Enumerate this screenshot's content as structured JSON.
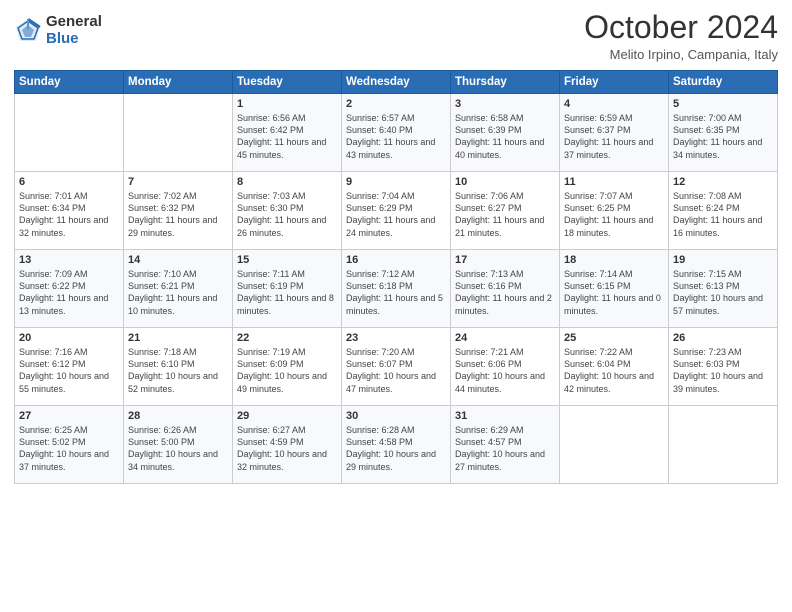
{
  "header": {
    "logo_general": "General",
    "logo_blue": "Blue",
    "month_title": "October 2024",
    "location": "Melito Irpino, Campania, Italy"
  },
  "days_of_week": [
    "Sunday",
    "Monday",
    "Tuesday",
    "Wednesday",
    "Thursday",
    "Friday",
    "Saturday"
  ],
  "weeks": [
    [
      {
        "day": "",
        "content": ""
      },
      {
        "day": "",
        "content": ""
      },
      {
        "day": "1",
        "content": "Sunrise: 6:56 AM\nSunset: 6:42 PM\nDaylight: 11 hours and 45 minutes."
      },
      {
        "day": "2",
        "content": "Sunrise: 6:57 AM\nSunset: 6:40 PM\nDaylight: 11 hours and 43 minutes."
      },
      {
        "day": "3",
        "content": "Sunrise: 6:58 AM\nSunset: 6:39 PM\nDaylight: 11 hours and 40 minutes."
      },
      {
        "day": "4",
        "content": "Sunrise: 6:59 AM\nSunset: 6:37 PM\nDaylight: 11 hours and 37 minutes."
      },
      {
        "day": "5",
        "content": "Sunrise: 7:00 AM\nSunset: 6:35 PM\nDaylight: 11 hours and 34 minutes."
      }
    ],
    [
      {
        "day": "6",
        "content": "Sunrise: 7:01 AM\nSunset: 6:34 PM\nDaylight: 11 hours and 32 minutes."
      },
      {
        "day": "7",
        "content": "Sunrise: 7:02 AM\nSunset: 6:32 PM\nDaylight: 11 hours and 29 minutes."
      },
      {
        "day": "8",
        "content": "Sunrise: 7:03 AM\nSunset: 6:30 PM\nDaylight: 11 hours and 26 minutes."
      },
      {
        "day": "9",
        "content": "Sunrise: 7:04 AM\nSunset: 6:29 PM\nDaylight: 11 hours and 24 minutes."
      },
      {
        "day": "10",
        "content": "Sunrise: 7:06 AM\nSunset: 6:27 PM\nDaylight: 11 hours and 21 minutes."
      },
      {
        "day": "11",
        "content": "Sunrise: 7:07 AM\nSunset: 6:25 PM\nDaylight: 11 hours and 18 minutes."
      },
      {
        "day": "12",
        "content": "Sunrise: 7:08 AM\nSunset: 6:24 PM\nDaylight: 11 hours and 16 minutes."
      }
    ],
    [
      {
        "day": "13",
        "content": "Sunrise: 7:09 AM\nSunset: 6:22 PM\nDaylight: 11 hours and 13 minutes."
      },
      {
        "day": "14",
        "content": "Sunrise: 7:10 AM\nSunset: 6:21 PM\nDaylight: 11 hours and 10 minutes."
      },
      {
        "day": "15",
        "content": "Sunrise: 7:11 AM\nSunset: 6:19 PM\nDaylight: 11 hours and 8 minutes."
      },
      {
        "day": "16",
        "content": "Sunrise: 7:12 AM\nSunset: 6:18 PM\nDaylight: 11 hours and 5 minutes."
      },
      {
        "day": "17",
        "content": "Sunrise: 7:13 AM\nSunset: 6:16 PM\nDaylight: 11 hours and 2 minutes."
      },
      {
        "day": "18",
        "content": "Sunrise: 7:14 AM\nSunset: 6:15 PM\nDaylight: 11 hours and 0 minutes."
      },
      {
        "day": "19",
        "content": "Sunrise: 7:15 AM\nSunset: 6:13 PM\nDaylight: 10 hours and 57 minutes."
      }
    ],
    [
      {
        "day": "20",
        "content": "Sunrise: 7:16 AM\nSunset: 6:12 PM\nDaylight: 10 hours and 55 minutes."
      },
      {
        "day": "21",
        "content": "Sunrise: 7:18 AM\nSunset: 6:10 PM\nDaylight: 10 hours and 52 minutes."
      },
      {
        "day": "22",
        "content": "Sunrise: 7:19 AM\nSunset: 6:09 PM\nDaylight: 10 hours and 49 minutes."
      },
      {
        "day": "23",
        "content": "Sunrise: 7:20 AM\nSunset: 6:07 PM\nDaylight: 10 hours and 47 minutes."
      },
      {
        "day": "24",
        "content": "Sunrise: 7:21 AM\nSunset: 6:06 PM\nDaylight: 10 hours and 44 minutes."
      },
      {
        "day": "25",
        "content": "Sunrise: 7:22 AM\nSunset: 6:04 PM\nDaylight: 10 hours and 42 minutes."
      },
      {
        "day": "26",
        "content": "Sunrise: 7:23 AM\nSunset: 6:03 PM\nDaylight: 10 hours and 39 minutes."
      }
    ],
    [
      {
        "day": "27",
        "content": "Sunrise: 6:25 AM\nSunset: 5:02 PM\nDaylight: 10 hours and 37 minutes."
      },
      {
        "day": "28",
        "content": "Sunrise: 6:26 AM\nSunset: 5:00 PM\nDaylight: 10 hours and 34 minutes."
      },
      {
        "day": "29",
        "content": "Sunrise: 6:27 AM\nSunset: 4:59 PM\nDaylight: 10 hours and 32 minutes."
      },
      {
        "day": "30",
        "content": "Sunrise: 6:28 AM\nSunset: 4:58 PM\nDaylight: 10 hours and 29 minutes."
      },
      {
        "day": "31",
        "content": "Sunrise: 6:29 AM\nSunset: 4:57 PM\nDaylight: 10 hours and 27 minutes."
      },
      {
        "day": "",
        "content": ""
      },
      {
        "day": "",
        "content": ""
      }
    ]
  ]
}
